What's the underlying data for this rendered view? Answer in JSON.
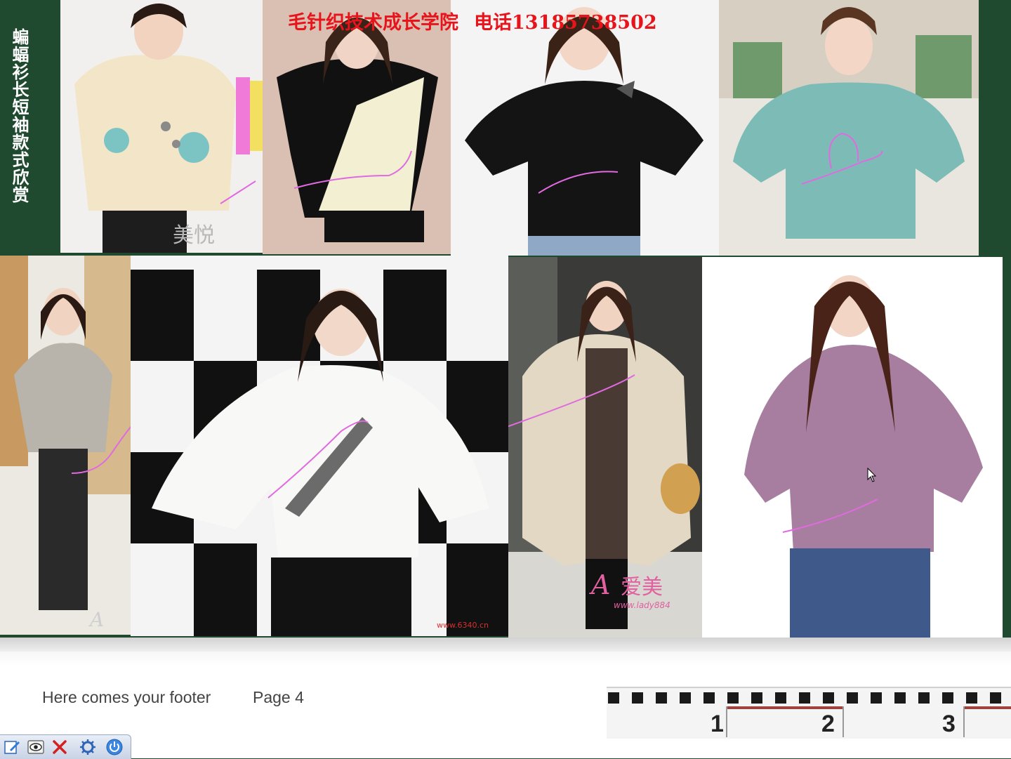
{
  "slide": {
    "vertical_title": "蝙蝠衫长短袖款式欣赏",
    "banner": {
      "school": "毛针织技术成长学院",
      "phone": "电话13185738502"
    },
    "watermarks": {
      "photo1": "美悦",
      "photo7": "爱美",
      "photo7_url": "www.lady884",
      "photo6_url": "www.6340.cn"
    },
    "colors": {
      "board": "#1f4a30",
      "banner_red": "#e8141b",
      "annotation": "#e06ae0"
    }
  },
  "footer": {
    "text": "Here comes your footer",
    "page": "Page 4"
  },
  "ruler": {
    "numbers": [
      "1",
      "2",
      "3"
    ]
  },
  "taskbar": {
    "buttons": [
      "edit-icon",
      "eye-icon",
      "close-icon",
      "tools-icon",
      "power-icon"
    ]
  }
}
